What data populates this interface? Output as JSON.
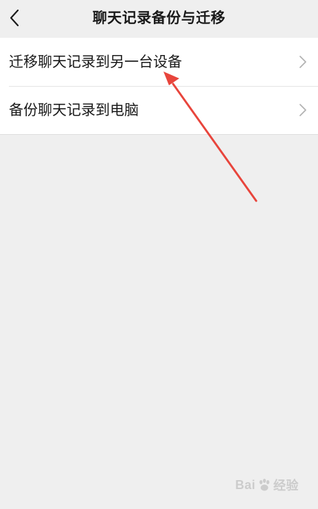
{
  "header": {
    "title": "聊天记录备份与迁移",
    "back_icon": "chevron-left-icon"
  },
  "menu": {
    "items": [
      {
        "label": "迁移聊天记录到另一台设备",
        "icon": "chevron-right-icon"
      },
      {
        "label": "备份聊天记录到电脑",
        "icon": "chevron-right-icon"
      }
    ]
  },
  "annotation": {
    "arrow_color": "#e8453c"
  },
  "watermark": {
    "brand_left": "Bai",
    "brand_right": "经验",
    "icon": "baidu-paw-icon"
  },
  "colors": {
    "background": "#efefef",
    "list_background": "#ffffff",
    "text": "#1a1a1a",
    "chevron": "#b2b2b2"
  }
}
